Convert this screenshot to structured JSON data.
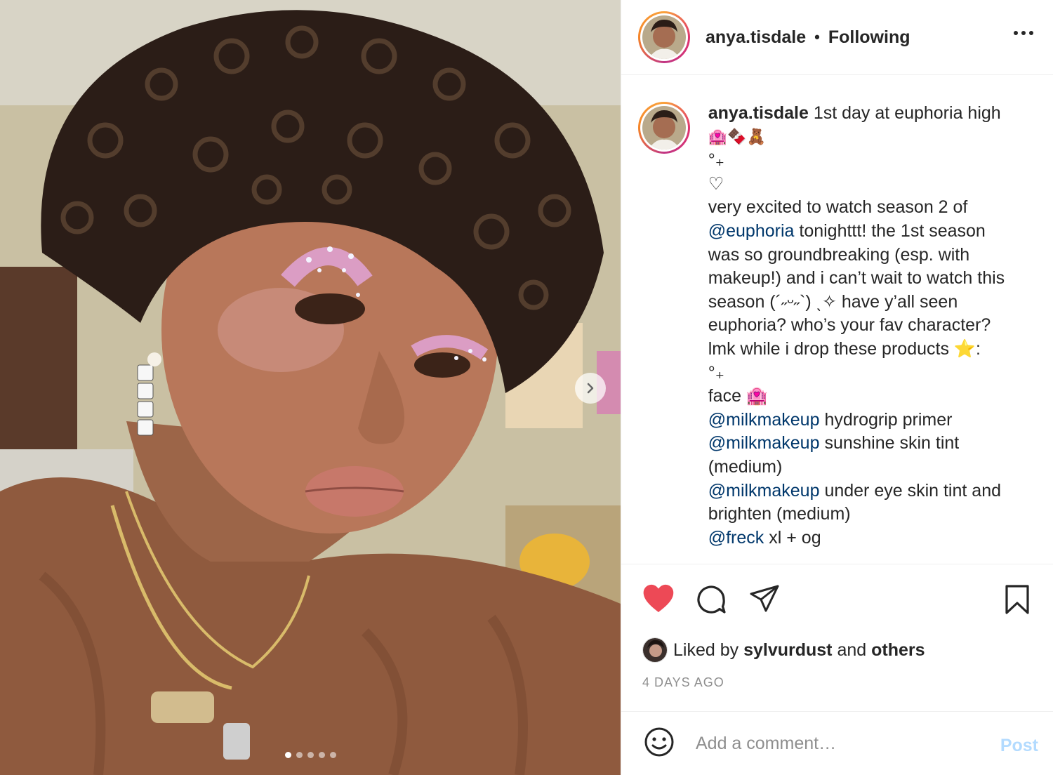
{
  "post": {
    "username": "anya.tisdale",
    "separator": "•",
    "follow_status": "Following",
    "slide_count": 5,
    "active_slide": 1
  },
  "caption": {
    "username": "anya.tisdale",
    "lines": [
      {
        "text": " 1st day at euphoria high"
      },
      {
        "text": "🏩🍫🧸",
        "emoji": true
      },
      {
        "text": "°₊"
      },
      {
        "text": "♡"
      },
      {
        "text": "very excited to watch season 2 of"
      },
      {
        "mention": "@euphoria",
        "text": " tonighttt! the 1st season"
      },
      {
        "text": "was so groundbreaking (esp. with"
      },
      {
        "text": "makeup!) and i can’t wait to watch this"
      },
      {
        "text": "season (´˶ᵕ˶`) ˎ✧ have y’all seen"
      },
      {
        "text": "euphoria? who’s your fav character?"
      },
      {
        "text": "lmk while i drop these products ⭐:"
      },
      {
        "text": "°₊"
      },
      {
        "text": "face 🏩"
      },
      {
        "mention": "@milkmakeup",
        "text": " hydrogrip primer"
      },
      {
        "mention": "@milkmakeup",
        "text": " sunshine skin tint"
      },
      {
        "text": "(medium)"
      },
      {
        "mention": "@milkmakeup",
        "text": " under eye skin tint and"
      },
      {
        "text": "brighten (medium)"
      },
      {
        "mention": "@freck",
        "text": " xl + og"
      }
    ]
  },
  "likes": {
    "prefix": "Liked by ",
    "user": "sylvurdust",
    "middle": " and ",
    "others": "others"
  },
  "timestamp": "4 DAYS AGO",
  "comment": {
    "placeholder": "Add a comment…",
    "post_label": "Post"
  },
  "icons": {
    "like": "heart-filled-icon",
    "comment": "comment-bubble-icon",
    "share": "paper-plane-icon",
    "save": "bookmark-icon",
    "emoji": "smiley-icon",
    "more": "more-dots-icon",
    "next": "chevron-right-icon"
  },
  "colors": {
    "like_red": "#ed4956",
    "mention_blue": "#00376b",
    "post_disabled": "#b3dbff",
    "meta_gray": "#8e8e8e"
  }
}
